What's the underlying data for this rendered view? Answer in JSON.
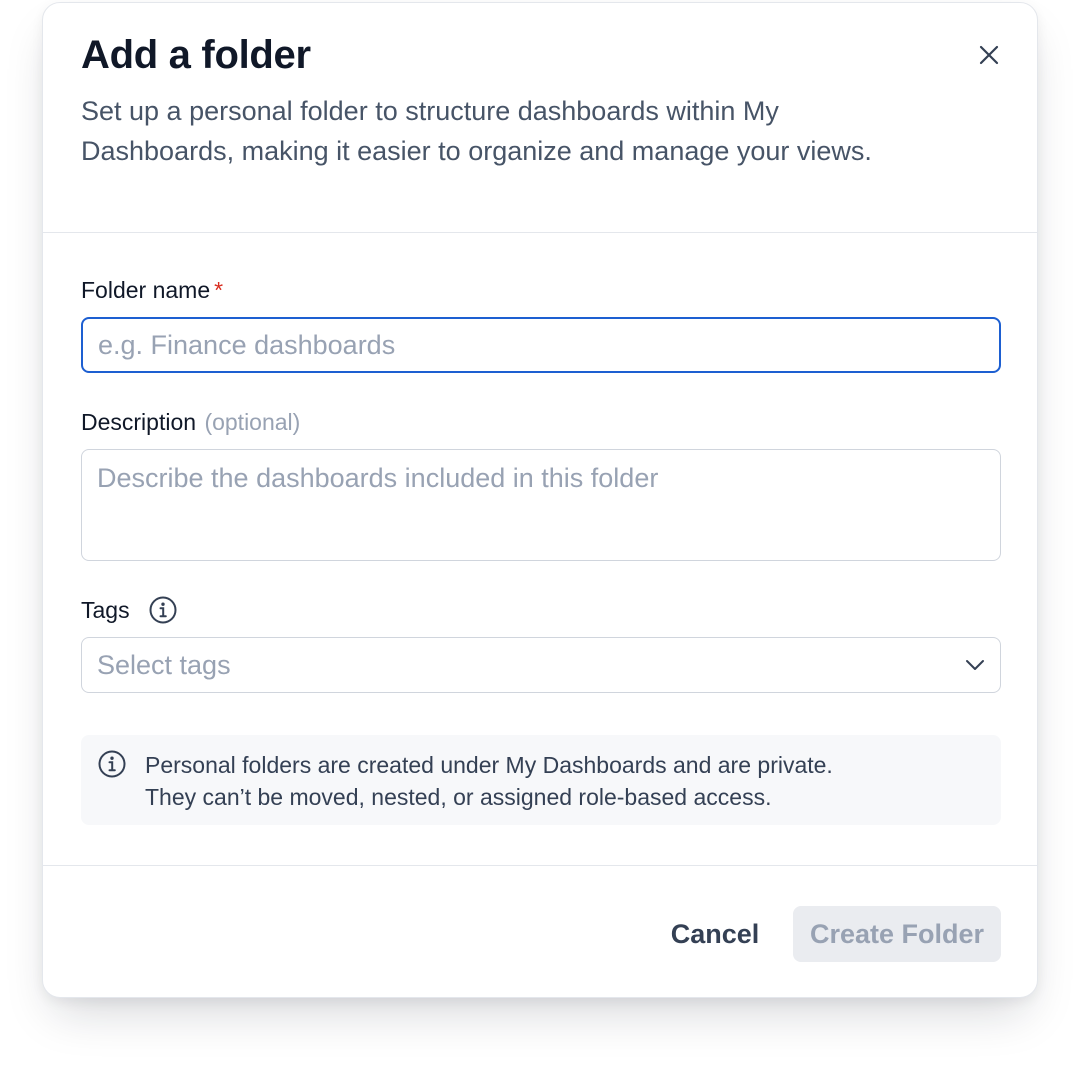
{
  "dialog": {
    "title": "Add a folder",
    "subtitle": "Set up a personal folder to structure dashboards within My Dashboards, making it easier to organize and manage your views."
  },
  "form": {
    "folder_name": {
      "label": "Folder name",
      "required_mark": "*",
      "placeholder": "e.g. Finance dashboards",
      "value": ""
    },
    "description": {
      "label": "Description",
      "optional_hint": "(optional)",
      "placeholder": "Describe the dashboards included in this folder",
      "value": ""
    },
    "tags": {
      "label": "Tags",
      "info_icon": "info-icon",
      "placeholder": "Select tags",
      "dropdown_icon": "chevron-down-icon"
    }
  },
  "notice": {
    "icon": "info-icon",
    "text_line1": "Personal folders are created under My Dashboards and are private.",
    "text_line2": "They can’t be moved, nested, or assigned role-based access."
  },
  "footer": {
    "cancel_label": "Cancel",
    "create_label": "Create Folder",
    "create_disabled": true
  },
  "colors": {
    "focus_border": "#1d5fd1",
    "required": "#d92d20",
    "disabled_bg": "#eaecf0",
    "disabled_text": "#98a2b3"
  }
}
